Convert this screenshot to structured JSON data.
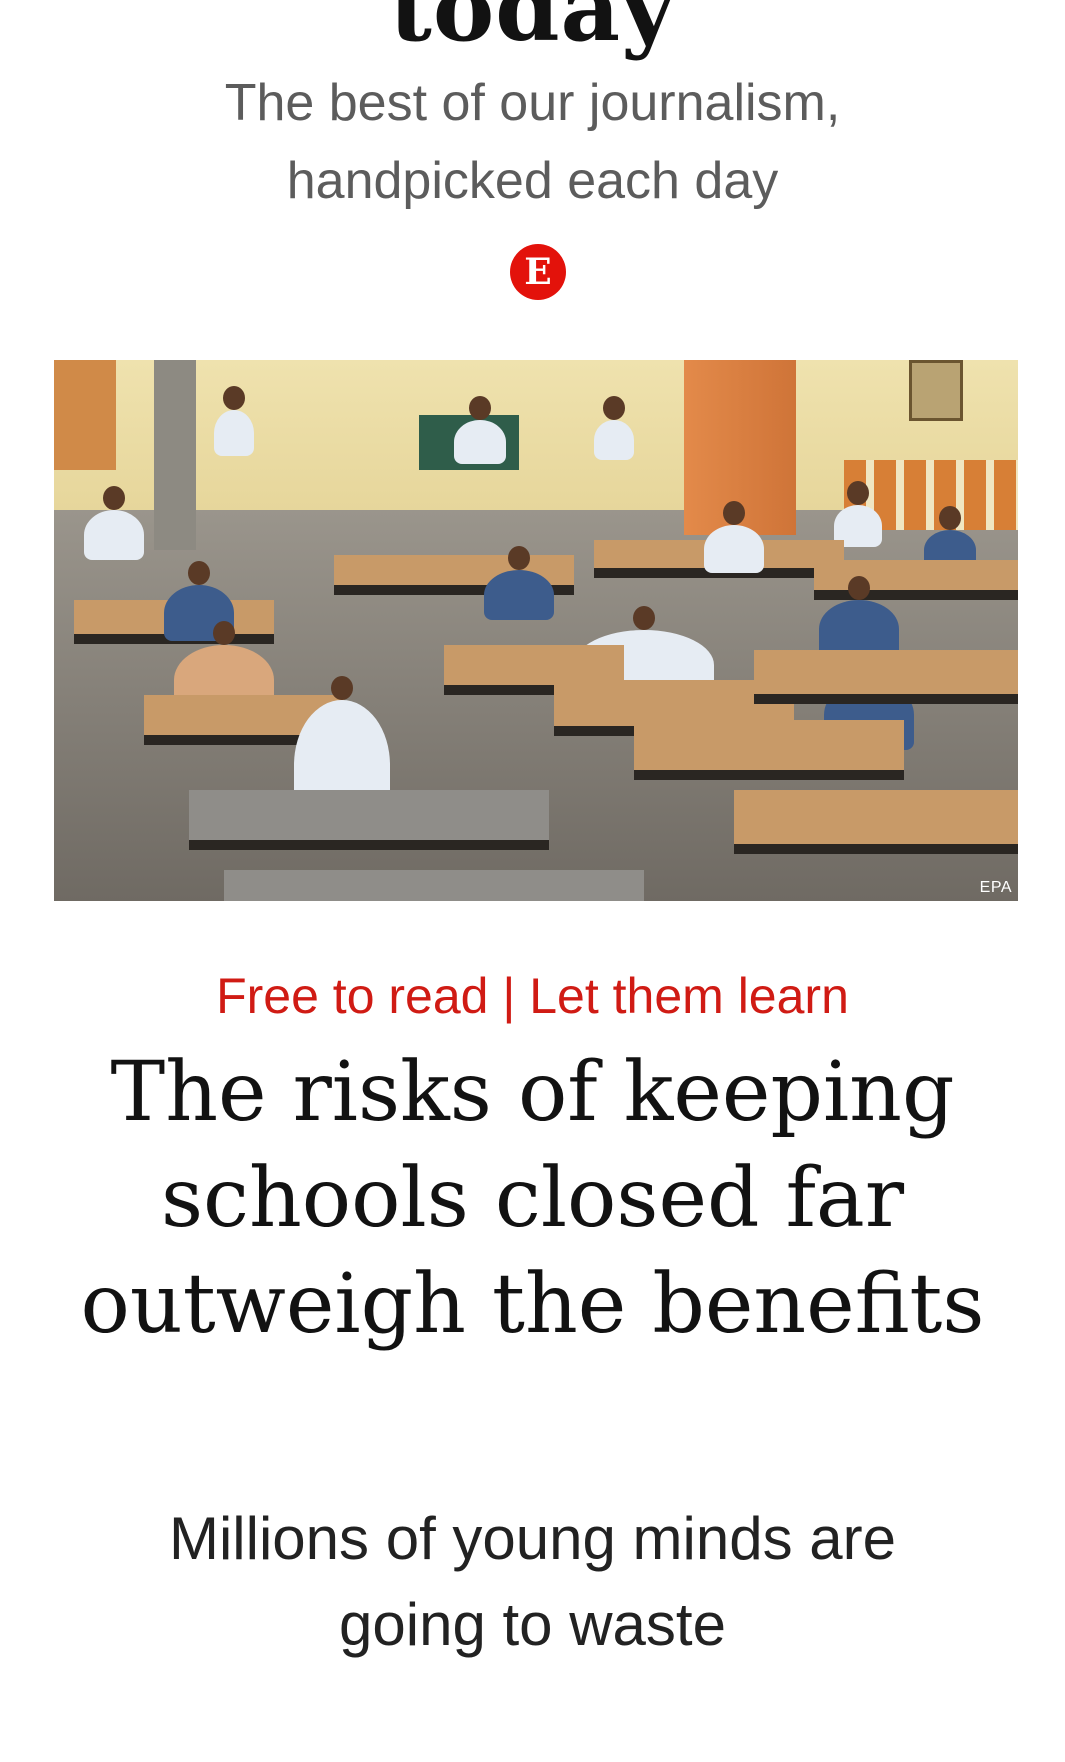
{
  "masthead": {
    "title": "today",
    "subtitle_line1": "The best of our journalism,",
    "subtitle_line2": "handpicked each day",
    "logo_letter": "E",
    "logo_color": "#e3120b"
  },
  "hero": {
    "credit": "EPA"
  },
  "article": {
    "rubric": "Free to read | Let them learn",
    "headline": "The risks of keeping schools closed far outweigh the benefits",
    "standfirst": "Millions of young minds are going to waste",
    "rubric_color": "#d01b14"
  }
}
